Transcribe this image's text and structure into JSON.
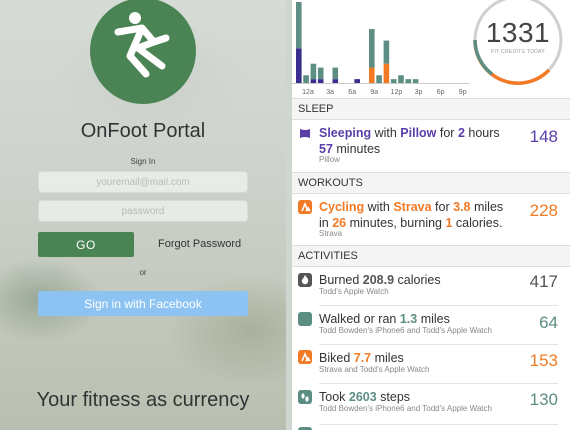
{
  "login": {
    "brand_name": "OnFoot Portal",
    "signin_label": "Sign In",
    "email_placeholder": "youremail@mail.com",
    "password_placeholder": "password",
    "go_label": "GO",
    "forgot_password": "Forgot Password",
    "or_label": "or",
    "facebook_label": "Sign in with Facebook",
    "tagline": "Your fitness as currency",
    "colors": {
      "brand_green": "#4b8454",
      "facebook_blue": "#8cc3f2"
    }
  },
  "dashboard": {
    "fit_credits": "1331",
    "fit_credits_label": "FIT CREDITS TODAY",
    "chart_data": {
      "type": "bar",
      "x_ticks": [
        "12a",
        "3a",
        "6a",
        "9a",
        "12p",
        "3p",
        "6p",
        "9p"
      ],
      "series": [
        {
          "color": "#3a2f8f",
          "values": [
            9,
            0,
            1,
            1,
            0,
            1,
            0,
            0,
            1,
            0,
            0,
            0,
            0,
            0,
            0,
            0,
            0,
            0,
            0,
            0,
            0,
            0,
            0,
            0
          ]
        },
        {
          "color": "#f27a24",
          "values": [
            0,
            0,
            0,
            0,
            0,
            0,
            0,
            0,
            0,
            0,
            4,
            0,
            5,
            0,
            0,
            0,
            0,
            0,
            0,
            0,
            0,
            0,
            0,
            0
          ]
        },
        {
          "color": "#5c8e84",
          "values": [
            12,
            2,
            4,
            3,
            0,
            3,
            0,
            0,
            0,
            0,
            10,
            2,
            6,
            1,
            2,
            1,
            1,
            0,
            0,
            0,
            0,
            0,
            0,
            0
          ]
        }
      ],
      "colors": {
        "ring_track": "#cfcfcf",
        "ring_progress": "#f27a24",
        "ring_secondary": "#5c8e84"
      }
    },
    "sections": {
      "sleep": "SLEEP",
      "workouts": "WORKOUTS",
      "activities": "ACTIVITIES"
    },
    "sleep_item": {
      "t1": "Sleeping",
      "t2": " with ",
      "t3": "Pillow",
      "t4": " for ",
      "t5": "2",
      "t6": " hours",
      "t7": "57",
      "t8": " minutes",
      "source": "Pillow",
      "value": "148",
      "color": "#5a3ea8"
    },
    "workout_item": {
      "t1": "Cycling",
      "t2": " with ",
      "t3": "Strava",
      "t4": " for ",
      "t5": "3.8",
      "t6": " miles",
      "t7": "in ",
      "t8": "26",
      "t9": " minutes, burning ",
      "t10": "1",
      "t11": " calories.",
      "source": "Strava",
      "value": "228",
      "color": "#f27a24"
    },
    "activities": [
      {
        "t1": "Burned ",
        "t2": "208.9",
        "t3": " calories",
        "source": "Todd's Apple Watch",
        "value": "417",
        "icon": "flame-icon",
        "icon_color": "#555555",
        "value_color": "#555555"
      },
      {
        "t1": "Walked or ran ",
        "t2": "1.3",
        "t3": " miles",
        "source": "Todd Bowden's iPhone6 and Todd's Apple Watch",
        "value": "64",
        "icon": "walk-icon",
        "icon_color": "#5c8e84",
        "value_color": "#5c8e84"
      },
      {
        "t1": "Biked ",
        "t2": "7.7",
        "t3": " miles",
        "source": "Strava and Todd's Apple Watch",
        "value": "153",
        "icon": "strava-icon",
        "icon_color": "#f27a24",
        "value_color": "#f27a24"
      },
      {
        "t1": "Took ",
        "t2": "2603",
        "t3": " steps",
        "source": "Todd Bowden's iPhone6 and Todd's Apple Watch",
        "value": "130",
        "icon": "footprints-icon",
        "icon_color": "#5c8e84",
        "value_color": "#5c8e84"
      }
    ]
  }
}
